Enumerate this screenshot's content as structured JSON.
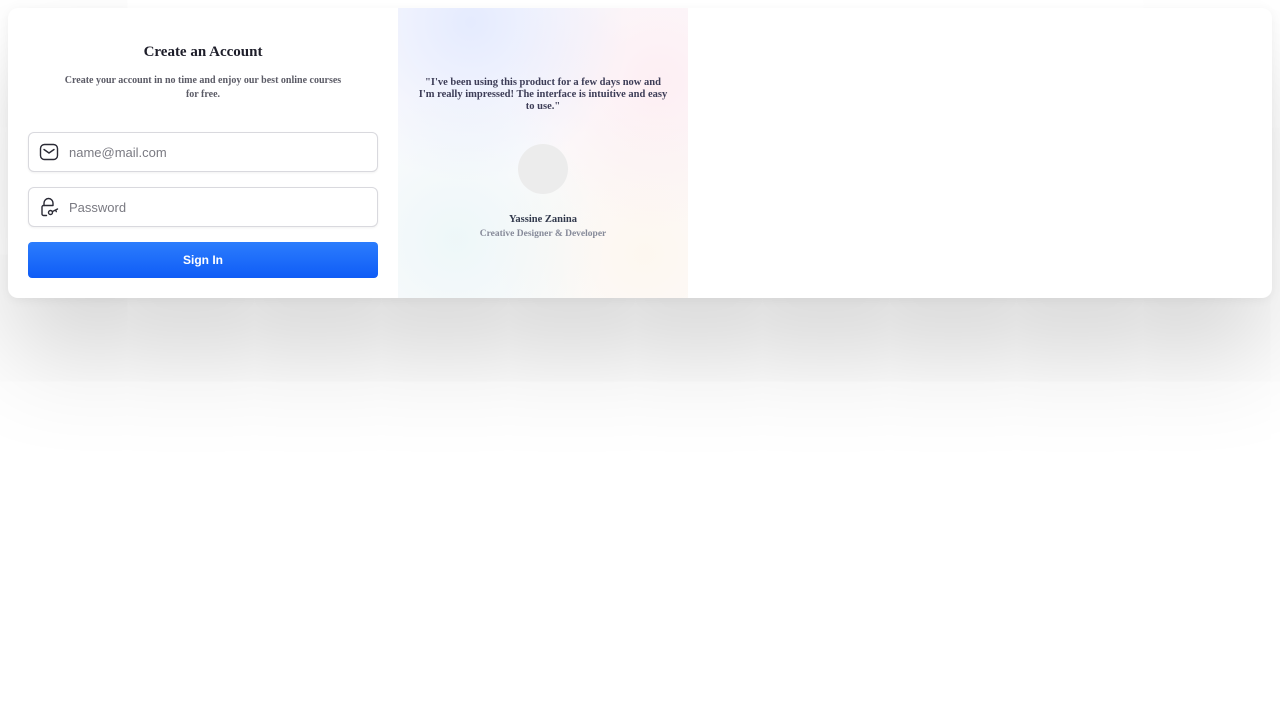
{
  "form": {
    "title": "Create an Account",
    "subtitle": "Create your account in no time and enjoy our best online courses for free.",
    "email": {
      "placeholder": "name@mail.com",
      "value": "",
      "icon": "mail-icon"
    },
    "password": {
      "placeholder": "Password",
      "value": "",
      "icon": "lock-icon"
    },
    "signin_label": "Sign In",
    "accent_color": "#0f5cf6"
  },
  "testimonial": {
    "quote": "\"I've been using this product for a few days now and I'm really impressed! The interface is intuitive and easy to use.\"",
    "author_name": "Yassine Zanina",
    "author_role": "Creative Designer & Developer"
  }
}
